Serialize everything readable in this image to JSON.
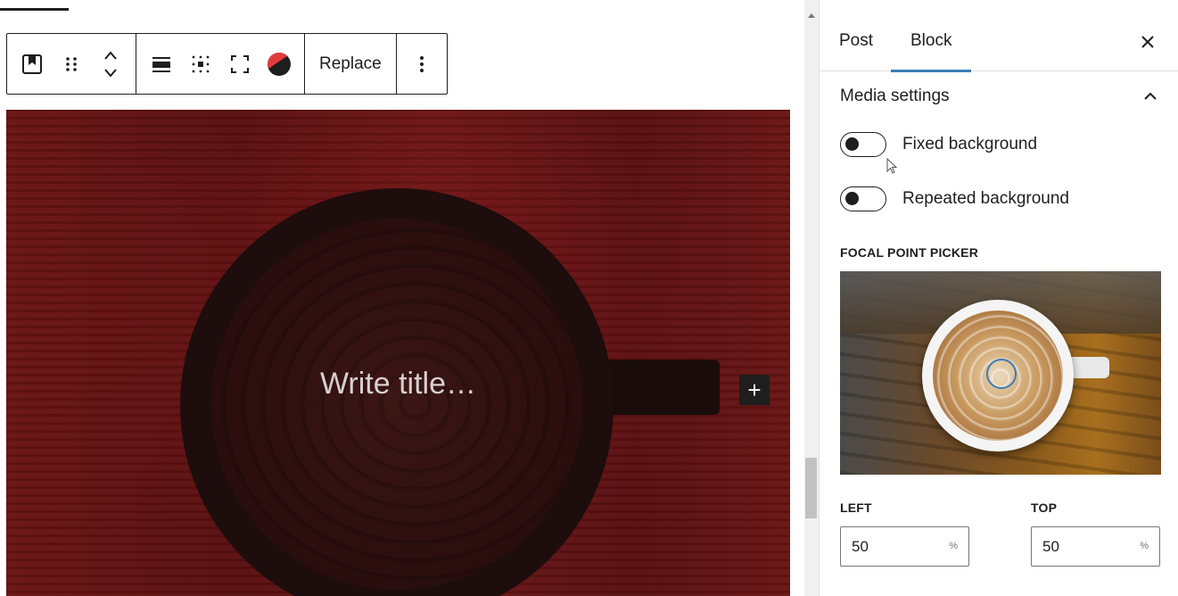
{
  "toolbar": {
    "replace_label": "Replace"
  },
  "cover": {
    "title_placeholder": "Write title…",
    "add_block_label": "+"
  },
  "sidebar": {
    "tabs": [
      {
        "label": "Post",
        "active": false
      },
      {
        "label": "Block",
        "active": true
      }
    ],
    "panel_title": "Media settings",
    "toggles": [
      {
        "label": "Fixed background",
        "checked": false
      },
      {
        "label": "Repeated background",
        "checked": false
      }
    ],
    "focal_point_label": "FOCAL POINT PICKER",
    "left_label": "LEFT",
    "top_label": "TOP",
    "left_value": "50",
    "top_value": "50",
    "unit": "%"
  },
  "colors": {
    "accent": "#3a7db5",
    "cover_overlay": "#6a1414",
    "text": "#1e1e1e"
  }
}
